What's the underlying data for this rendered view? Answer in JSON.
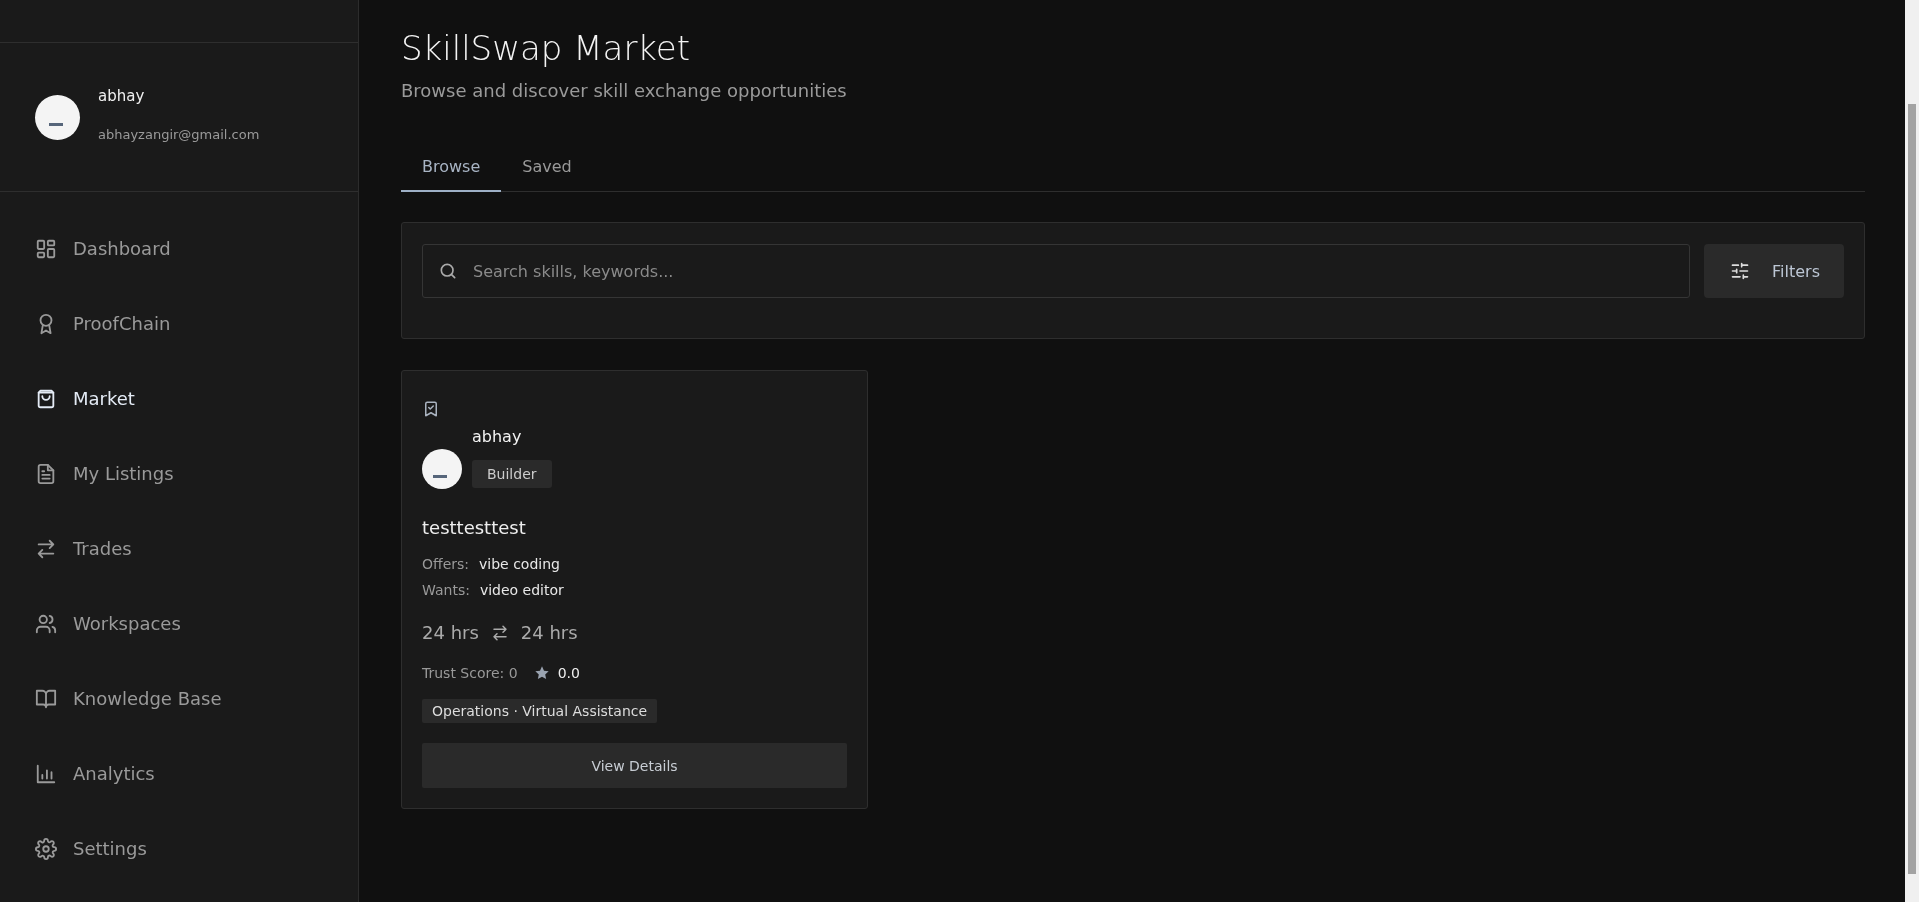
{
  "profile": {
    "name": "abhay",
    "email": "abhayzangir@gmail.com"
  },
  "nav": [
    {
      "label": "Dashboard",
      "selected": false
    },
    {
      "label": "ProofChain",
      "selected": false
    },
    {
      "label": "Market",
      "selected": true
    },
    {
      "label": "My Listings",
      "selected": false
    },
    {
      "label": "Trades",
      "selected": false
    },
    {
      "label": "Workspaces",
      "selected": false
    },
    {
      "label": "Knowledge Base",
      "selected": false
    },
    {
      "label": "Analytics",
      "selected": false
    },
    {
      "label": "Settings",
      "selected": false
    }
  ],
  "header": {
    "title": "SkillSwap Market",
    "subtitle": "Browse and discover skill exchange opportunities"
  },
  "tabs": [
    {
      "label": "Browse",
      "selected": true
    },
    {
      "label": "Saved",
      "selected": false
    }
  ],
  "search": {
    "placeholder": "Search skills, keywords...",
    "filters_button": "Filters"
  },
  "listings": [
    {
      "user": "abhay",
      "badge": "Builder",
      "title": "testtesttest",
      "offers_label": "Offers:",
      "offers": "vibe coding",
      "wants_label": "Wants:",
      "wants": "video editor",
      "hours_offered": "24 hrs",
      "hours_wanted": "24 hrs",
      "trust_score": "Trust Score: 0",
      "rating": "0.0",
      "category": "Operations · Virtual Assistance",
      "button": "View Details"
    }
  ]
}
